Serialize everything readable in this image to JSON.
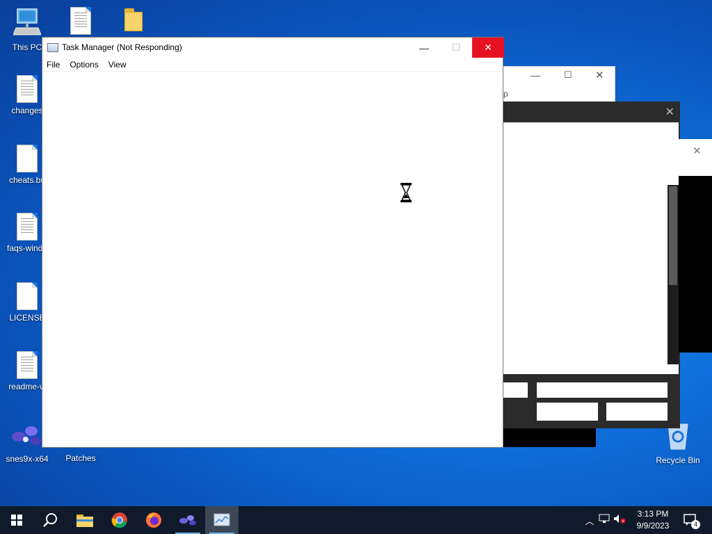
{
  "desktop": {
    "icons": [
      {
        "label": "This PC",
        "icon": "computer-icon"
      },
      {
        "label": "changes",
        "icon": "text-document-icon"
      },
      {
        "label": "cheats.bn",
        "icon": "blank-document-icon"
      },
      {
        "label": "faqs-windo",
        "icon": "text-document-icon"
      },
      {
        "label": "LICENSE",
        "icon": "blank-document-icon"
      },
      {
        "label": "readme-w",
        "icon": "text-document-icon"
      },
      {
        "label": "snes9x-x64",
        "icon": "snes9x-app-icon"
      },
      {
        "label": "Patches",
        "icon": "folder-icon"
      },
      {
        "label": "Recycle Bin",
        "icon": "recycle-bin-icon"
      }
    ]
  },
  "task_manager": {
    "title": "Task Manager (Not Responding)",
    "menu": [
      "File",
      "Options",
      "View"
    ],
    "controls": {
      "minimize": "—",
      "maximize": "☐",
      "close": "✕"
    }
  },
  "background_window": {
    "partial_text": "p"
  },
  "taskbar": {
    "items": [
      "start-icon",
      "search-icon",
      "file-explorer-icon",
      "chrome-icon",
      "firefox-icon",
      "snes9x-icon",
      "task-manager-icon"
    ],
    "notification_count": "4"
  },
  "clock": {
    "time": "3:13 PM",
    "date": "9/9/2023"
  }
}
